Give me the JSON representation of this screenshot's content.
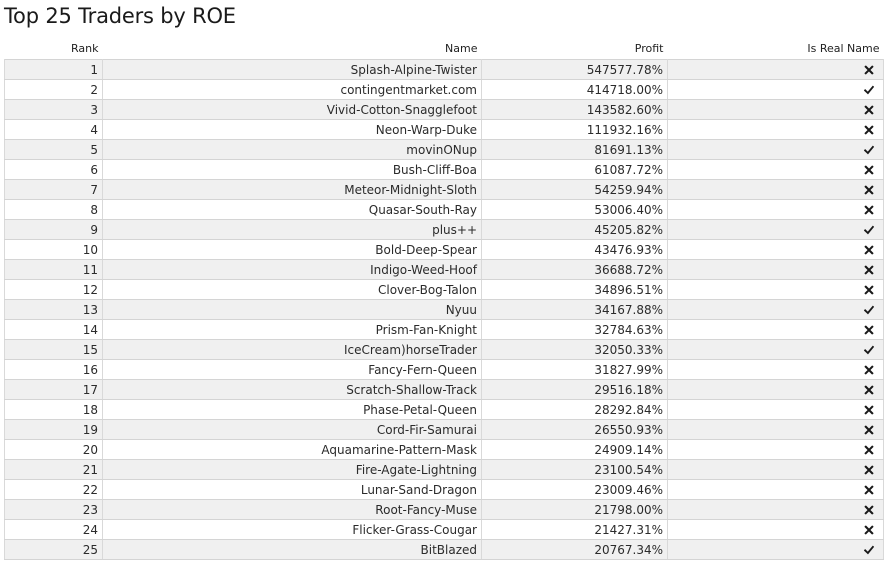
{
  "page": {
    "title": "Top 25 Traders by ROE"
  },
  "table": {
    "columns": {
      "rank": "Rank",
      "name": "Name",
      "profit": "Profit",
      "is_real_name": "Is Real Name"
    },
    "rows": [
      {
        "rank": "1",
        "name": "Splash-Alpine-Twister",
        "profit": "547577.78%",
        "is_real_name": false
      },
      {
        "rank": "2",
        "name": "contingentmarket.com",
        "profit": "414718.00%",
        "is_real_name": true
      },
      {
        "rank": "3",
        "name": "Vivid-Cotton-Snagglefoot",
        "profit": "143582.60%",
        "is_real_name": false
      },
      {
        "rank": "4",
        "name": "Neon-Warp-Duke",
        "profit": "111932.16%",
        "is_real_name": false
      },
      {
        "rank": "5",
        "name": "movinONup",
        "profit": "81691.13%",
        "is_real_name": true
      },
      {
        "rank": "6",
        "name": "Bush-Cliff-Boa",
        "profit": "61087.72%",
        "is_real_name": false
      },
      {
        "rank": "7",
        "name": "Meteor-Midnight-Sloth",
        "profit": "54259.94%",
        "is_real_name": false
      },
      {
        "rank": "8",
        "name": "Quasar-South-Ray",
        "profit": "53006.40%",
        "is_real_name": false
      },
      {
        "rank": "9",
        "name": "plus++",
        "profit": "45205.82%",
        "is_real_name": true
      },
      {
        "rank": "10",
        "name": "Bold-Deep-Spear",
        "profit": "43476.93%",
        "is_real_name": false
      },
      {
        "rank": "11",
        "name": "Indigo-Weed-Hoof",
        "profit": "36688.72%",
        "is_real_name": false
      },
      {
        "rank": "12",
        "name": "Clover-Bog-Talon",
        "profit": "34896.51%",
        "is_real_name": false
      },
      {
        "rank": "13",
        "name": "Nyuu",
        "profit": "34167.88%",
        "is_real_name": true
      },
      {
        "rank": "14",
        "name": "Prism-Fan-Knight",
        "profit": "32784.63%",
        "is_real_name": false
      },
      {
        "rank": "15",
        "name": "IceCream)horseTrader",
        "profit": "32050.33%",
        "is_real_name": true
      },
      {
        "rank": "16",
        "name": "Fancy-Fern-Queen",
        "profit": "31827.99%",
        "is_real_name": false
      },
      {
        "rank": "17",
        "name": "Scratch-Shallow-Track",
        "profit": "29516.18%",
        "is_real_name": false
      },
      {
        "rank": "18",
        "name": "Phase-Petal-Queen",
        "profit": "28292.84%",
        "is_real_name": false
      },
      {
        "rank": "19",
        "name": "Cord-Fir-Samurai",
        "profit": "26550.93%",
        "is_real_name": false
      },
      {
        "rank": "20",
        "name": "Aquamarine-Pattern-Mask",
        "profit": "24909.14%",
        "is_real_name": false
      },
      {
        "rank": "21",
        "name": "Fire-Agate-Lightning",
        "profit": "23100.54%",
        "is_real_name": false
      },
      {
        "rank": "22",
        "name": "Lunar-Sand-Dragon",
        "profit": "23009.46%",
        "is_real_name": false
      },
      {
        "rank": "23",
        "name": "Root-Fancy-Muse",
        "profit": "21798.00%",
        "is_real_name": false
      },
      {
        "rank": "24",
        "name": "Flicker-Grass-Cougar",
        "profit": "21427.31%",
        "is_real_name": false
      },
      {
        "rank": "25",
        "name": "BitBlazed",
        "profit": "20767.34%",
        "is_real_name": true
      }
    ]
  },
  "icons": {
    "true": "check-icon",
    "false": "cross-icon"
  },
  "colors": {
    "row_alt": "#f0f0f0",
    "row": "#ffffff",
    "border": "#d4d4d4",
    "text": "#2b2b2b",
    "icon": "#1a1a1a"
  }
}
